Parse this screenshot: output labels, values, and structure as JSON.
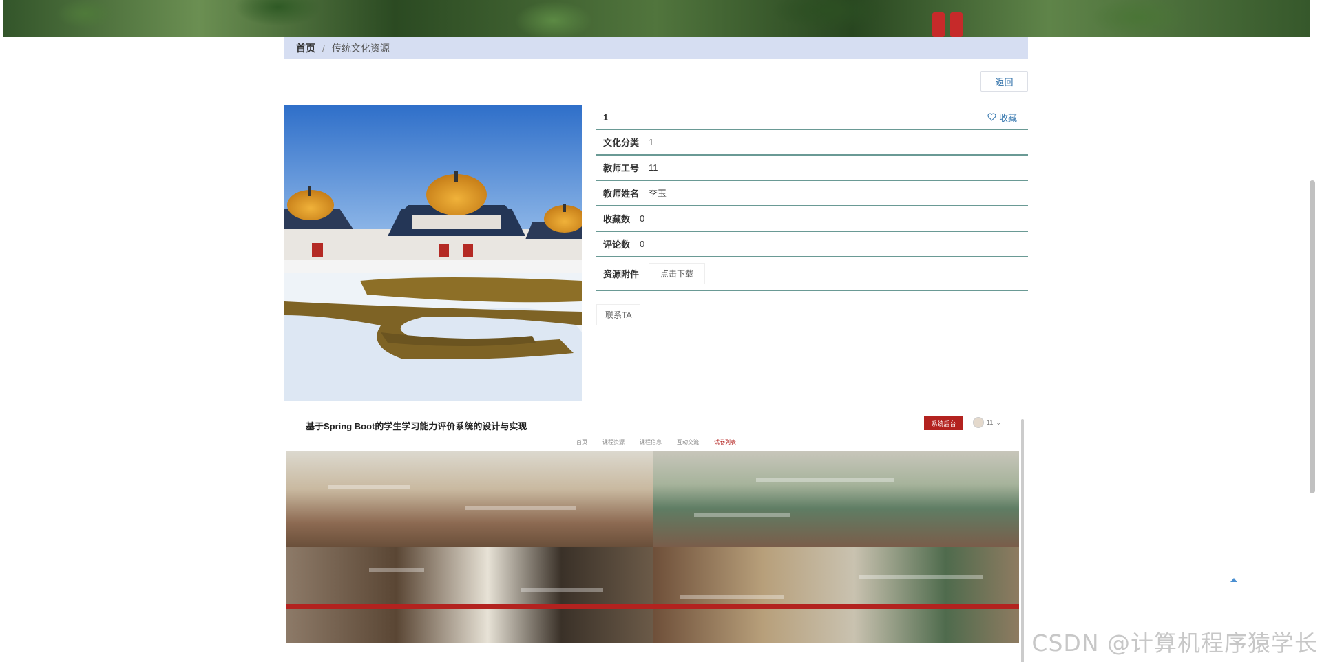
{
  "breadcrumb": {
    "home": "首页",
    "separator": "/",
    "current": "传统文化资源"
  },
  "actions": {
    "back_label": "返回",
    "favorite_label": "收藏",
    "favorite_icon": "heart-outline-icon"
  },
  "detail": {
    "title": "1",
    "fields": [
      {
        "label": "文化分类",
        "value": "1"
      },
      {
        "label": "教师工号",
        "value": "11"
      },
      {
        "label": "教师姓名",
        "value": "李玉"
      },
      {
        "label": "收藏数",
        "value": "0"
      },
      {
        "label": "评论数",
        "value": "0"
      }
    ],
    "attachment": {
      "label": "资源附件",
      "button": "点击下载"
    },
    "contact_label": "联系TA"
  },
  "embedded_page": {
    "title": "基于Spring Boot的学生学习能力评价系统的设计与实现",
    "admin_button": "系统后台",
    "user": "11",
    "nav": [
      "首页",
      "课程资源",
      "课程信息",
      "互动交流",
      "试卷列表"
    ],
    "active_nav": "试卷列表"
  },
  "watermark": "CSDN @计算机程序猿学长",
  "colors": {
    "accent": "#2e6fa8",
    "row_border": "#6a9a95",
    "breadcrumb_bg": "#d6def2",
    "brand_red": "#b3221f"
  }
}
